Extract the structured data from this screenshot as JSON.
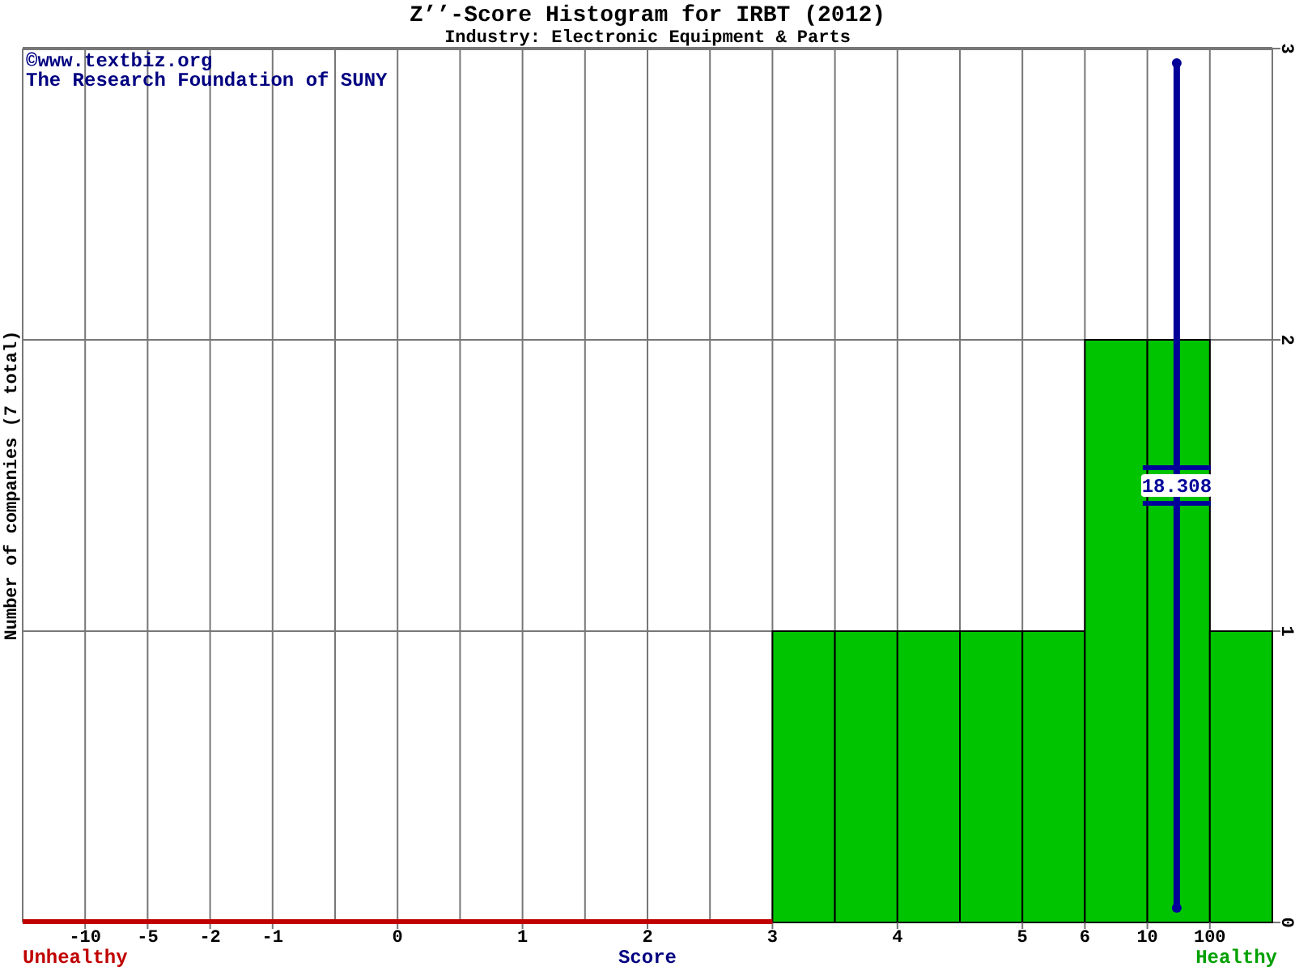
{
  "title": "Z’’-Score Histogram for IRBT (2012)",
  "subtitle": "Industry: Electronic Equipment & Parts",
  "copyright": [
    "©www.textbiz.org",
    "The Research Foundation of SUNY"
  ],
  "chart_data": {
    "type": "bar",
    "ylabel": "Number of companies (7 total)",
    "xlabel": "Score",
    "categories": [
      null,
      "-10",
      "-5",
      "-2",
      "-1",
      null,
      "0",
      null,
      "1",
      null,
      "2",
      null,
      "3",
      null,
      "4",
      null,
      "5",
      "6",
      "10",
      "100"
    ],
    "values": [
      0,
      0,
      0,
      0,
      0,
      0,
      0,
      0,
      0,
      0,
      0,
      0,
      1,
      1,
      1,
      1,
      1,
      2,
      2,
      1
    ],
    "ylim": [
      0,
      3
    ],
    "yticks": [
      0,
      1,
      2,
      3
    ],
    "grid": true,
    "annotations": [
      "18.308"
    ]
  },
  "left_label": "Unhealthy",
  "right_label": "Healthy"
}
